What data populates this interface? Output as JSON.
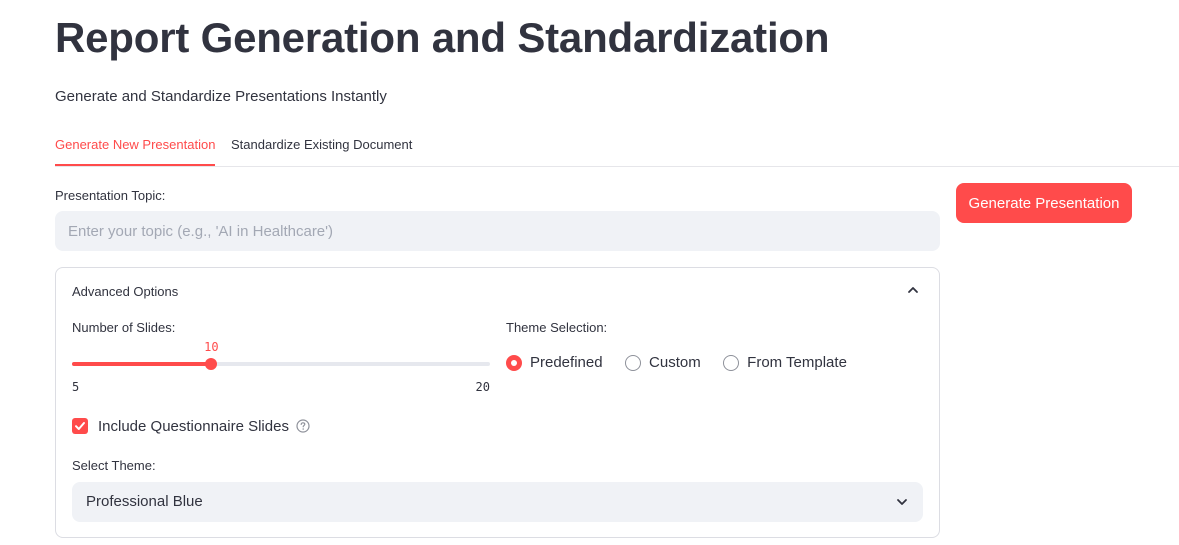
{
  "page": {
    "title": "Report Generation and Standardization",
    "subtitle": "Generate and Standardize Presentations Instantly"
  },
  "tabs": [
    {
      "label": "Generate New Presentation",
      "active": true
    },
    {
      "label": "Standardize Existing Document",
      "active": false
    }
  ],
  "topic": {
    "label": "Presentation Topic:",
    "placeholder": "Enter your topic (e.g., 'AI in Healthcare')",
    "value": ""
  },
  "generate_button": {
    "label": "Generate Presentation"
  },
  "advanced": {
    "title": "Advanced Options",
    "expanded": true,
    "slides": {
      "label": "Number of Slides:",
      "value": 10,
      "min": 5,
      "max": 20
    },
    "theme_selection": {
      "label": "Theme Selection:",
      "options": [
        "Predefined",
        "Custom",
        "From Template"
      ],
      "selected": "Predefined"
    },
    "questionnaire": {
      "label": "Include Questionnaire Slides",
      "checked": true
    },
    "select_theme": {
      "label": "Select Theme:",
      "value": "Professional Blue"
    }
  },
  "icons": {
    "expander_toggle": "chevron-up-icon",
    "select_toggle": "chevron-down-icon",
    "help": "help-circle-icon",
    "check": "check-icon"
  },
  "colors": {
    "accent": "#ff4b4b",
    "text": "#31333f",
    "input_bg": "#f0f2f6",
    "border": "#dcdde3"
  }
}
